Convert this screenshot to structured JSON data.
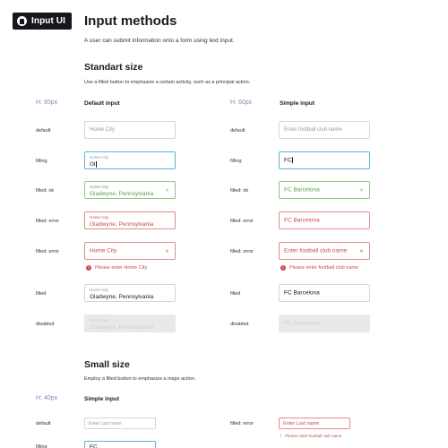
{
  "logo": {
    "text": "Input UI",
    "icon": "input-ui-logo-icon"
  },
  "page": {
    "title": "Input methods",
    "description": "A user can submit information onto a form using text input."
  },
  "standard": {
    "title": "Standart size",
    "description": "Use a filled button to emphasize a certain activity, such as a principal action.",
    "height_label_left": "H: 60px",
    "height_label_right": "H: 60px",
    "left_header": "Default input",
    "right_header": "Simple input",
    "rows": [
      {
        "label": "default"
      },
      {
        "label": "filling"
      },
      {
        "label": "filled: ok"
      },
      {
        "label": "filled: error"
      },
      {
        "label": "filled: error"
      },
      {
        "label": "filled"
      },
      {
        "label": "disabled"
      }
    ],
    "left": {
      "default_placeholder": "Home City",
      "filling_label": "Home City",
      "filling_value": "Gl",
      "ok_label": "Home City",
      "ok_value": "Gladwyne, Pennsylvania",
      "error_label": "Home City",
      "error_value": "Gladwyne, Pennsylvania",
      "error_placeholder": "Home City",
      "error_message": "Please enter Home City",
      "filled_label": "Home City",
      "filled_value": "Gladwyne, Pennsylvania",
      "disabled_label": "Home City",
      "disabled_value": "Gladwyne, Pennsylvania"
    },
    "right": {
      "default_placeholder": "Enter football club name",
      "filling_value": "FC",
      "ok_value": "FC Barcelona",
      "error_value": "FC Barcelona",
      "error_placeholder": "Enter football club name",
      "error_message": "Please enter football club name",
      "filled_value": "FC Barcelona",
      "disabled_value": "FC Barcelona"
    }
  },
  "small": {
    "title": "Small size",
    "description": "Employ a filled button to emphasize a major action.",
    "height_label": "H: 40px",
    "header": "Simple input",
    "rows_left": [
      {
        "label": "default"
      },
      {
        "label": "filling"
      }
    ],
    "rows_right": [
      {
        "label": "filled: error"
      }
    ],
    "left": {
      "default_placeholder": "Enter Last name",
      "filling_value": "FC"
    },
    "right": {
      "error_value": "Enter Last name",
      "error_message": "Please enter football club name"
    }
  },
  "colors": {
    "focus": "#5bb3d9",
    "ok": "#5e9e4f",
    "error": "#c94b4b",
    "hint": "#7a92b5"
  }
}
